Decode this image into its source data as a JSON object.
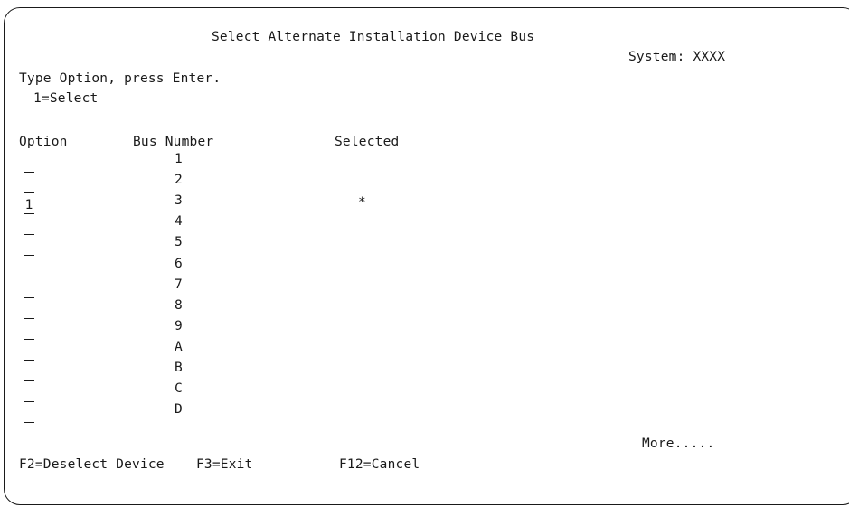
{
  "screen": {
    "title": "Select Alternate Installation Device Bus",
    "system_label": "System: XXXX",
    "instruction": "Type Option, press Enter.",
    "option_legend": "1=Select",
    "more_indicator": "More....."
  },
  "table": {
    "headers": {
      "option": "Option",
      "bus_number": "Bus Number",
      "selected": "Selected"
    },
    "rows": [
      {
        "option": "",
        "bus": "1",
        "selected": ""
      },
      {
        "option": "",
        "bus": "2",
        "selected": ""
      },
      {
        "option": "1",
        "bus": "3",
        "selected": "*"
      },
      {
        "option": "",
        "bus": "4",
        "selected": ""
      },
      {
        "option": "",
        "bus": "5",
        "selected": ""
      },
      {
        "option": "",
        "bus": "6",
        "selected": ""
      },
      {
        "option": "",
        "bus": "7",
        "selected": ""
      },
      {
        "option": "",
        "bus": "8",
        "selected": ""
      },
      {
        "option": "",
        "bus": "9",
        "selected": ""
      },
      {
        "option": "",
        "bus": "A",
        "selected": ""
      },
      {
        "option": "",
        "bus": "B",
        "selected": ""
      },
      {
        "option": "",
        "bus": "C",
        "selected": ""
      },
      {
        "option": "",
        "bus": "D",
        "selected": ""
      }
    ]
  },
  "function_keys": {
    "f2": "F2=Deselect Device",
    "f3": "F3=Exit",
    "f12": "F12=Cancel"
  }
}
